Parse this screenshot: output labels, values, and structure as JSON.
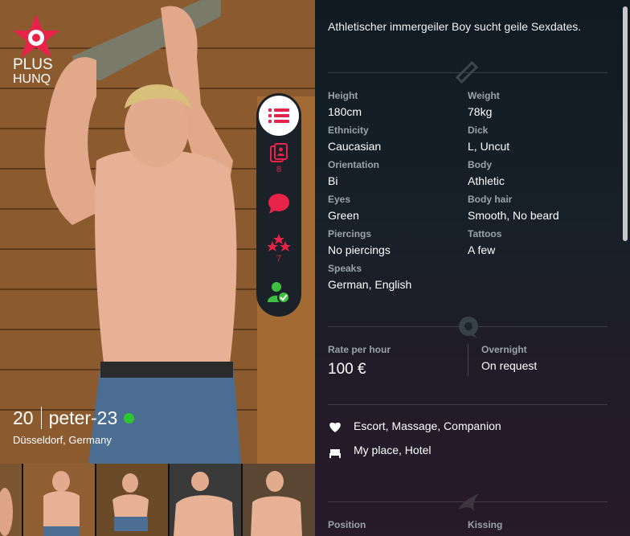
{
  "profile": {
    "badge_text": "PLUS",
    "badge_sub": "HUNQ",
    "age": "20",
    "username": "peter-23",
    "location": "Düsseldorf, Germany",
    "online_color": "#2ec531"
  },
  "actions": {
    "photos_count": "8",
    "ratings_count": "7"
  },
  "intro": "Athletischer immergeiler Boy sucht geile Sexdates.",
  "attributes": [
    {
      "label": "Height",
      "value": "180cm"
    },
    {
      "label": "Weight",
      "value": "78kg"
    },
    {
      "label": "Ethnicity",
      "value": "Caucasian"
    },
    {
      "label": "Dick",
      "value": "L, Uncut"
    },
    {
      "label": "Orientation",
      "value": "Bi"
    },
    {
      "label": "Body",
      "value": "Athletic"
    },
    {
      "label": "Eyes",
      "value": "Green"
    },
    {
      "label": "Body hair",
      "value": "Smooth, No beard"
    },
    {
      "label": "Piercings",
      "value": "No piercings"
    },
    {
      "label": "Tattoos",
      "value": "A few"
    },
    {
      "label": "Speaks",
      "value": "German, English"
    }
  ],
  "rates": {
    "hour_label": "Rate per hour",
    "hour_value": "100 €",
    "overnight_label": "Overnight",
    "overnight_value": "On request"
  },
  "services": [
    {
      "icon": "heart-icon",
      "text": "Escort, Massage, Companion"
    },
    {
      "icon": "bed-icon",
      "text": "My place, Hotel"
    }
  ],
  "bottom": {
    "position_label": "Position",
    "kissing_label": "Kissing"
  },
  "colors": {
    "accent": "#e8234a",
    "online": "#2ec531"
  }
}
